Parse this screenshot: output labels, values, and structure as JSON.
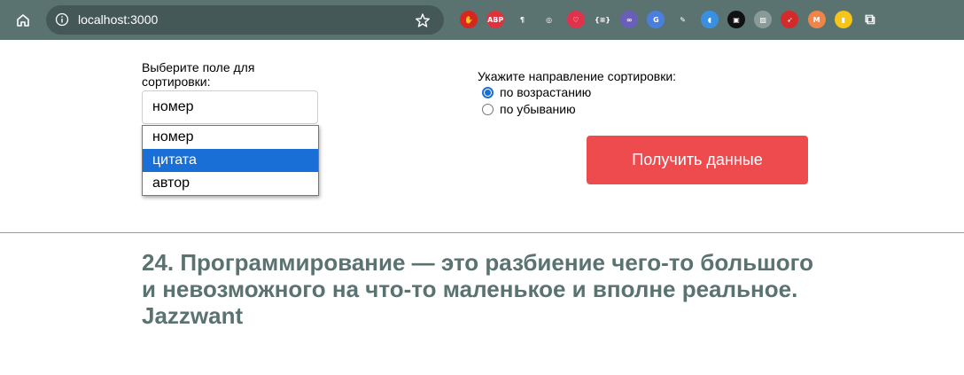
{
  "browser": {
    "url": "localhost:3000",
    "extensions": [
      {
        "name": "ublock-icon",
        "color": "#d6261f",
        "text": "✋"
      },
      {
        "name": "abp-icon",
        "color": "#e0323d",
        "text": "ABP"
      },
      {
        "name": "paragraph-icon",
        "color": "#5a7371",
        "text": "¶"
      },
      {
        "name": "globe-icon",
        "color": "#5a7371",
        "text": "◎"
      },
      {
        "name": "pocket-icon",
        "color": "#e0324c",
        "text": "♡"
      },
      {
        "name": "json-icon",
        "color": "#5a7371",
        "text": "{≡}"
      },
      {
        "name": "link-icon",
        "color": "#6a5fb8",
        "text": "∞"
      },
      {
        "name": "translate-icon",
        "color": "#4a7fe0",
        "text": "G"
      },
      {
        "name": "eyedropper-icon",
        "color": "#5a7371",
        "text": "✎"
      },
      {
        "name": "audio-icon",
        "color": "#3b8fe0",
        "text": "◖"
      },
      {
        "name": "square-icon",
        "color": "#111111",
        "text": "▣"
      },
      {
        "name": "stripes-icon",
        "color": "#8a9a98",
        "text": "▨"
      },
      {
        "name": "rocket-icon",
        "color": "#d42a2a",
        "text": "➶"
      },
      {
        "name": "metamask-icon",
        "color": "#f0854a",
        "text": "M"
      },
      {
        "name": "bulb-icon",
        "color": "#f5c518",
        "text": "▮"
      },
      {
        "name": "extensions-puzzle-icon",
        "color": "#5a7371",
        "text": "⧉"
      }
    ]
  },
  "sort_field": {
    "label": "Выберите поле для сортировки:",
    "selected": "номер",
    "options": [
      "номер",
      "цитата",
      "автор"
    ],
    "highlighted_index": 1
  },
  "sort_direction": {
    "label": "Укажите направление сортировки:",
    "options": [
      "по возрастанию",
      "по убыванию"
    ],
    "checked_index": 0
  },
  "fetch_button": {
    "label": "Получить данные"
  },
  "quote": {
    "text": "24. Программирование — это разбиение чего-то большого и невозможного на что-то маленькое и вполне реальное. Jazzwant"
  },
  "colors": {
    "toolbar": "#5a7371",
    "accent": "#1a6fd6",
    "button": "#ee4b4f"
  }
}
